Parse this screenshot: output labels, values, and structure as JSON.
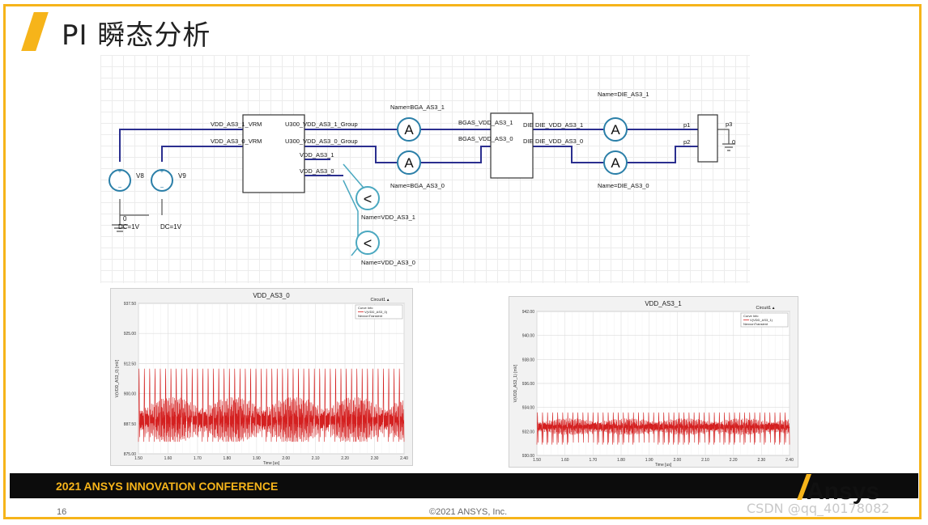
{
  "slide": {
    "title": "PI 瞬态分析",
    "footer_text": "2021 ANSYS INNOVATION CONFERENCE",
    "page_number": "16",
    "copyright": "©2021 ANSYS, Inc.",
    "logo_text": "Ansys",
    "watermark": "CSDN @qq_40178082"
  },
  "colors": {
    "accent": "#f6b41a",
    "footer_bg": "#0c0c0c",
    "wire": "#2b2f8f",
    "probe": "#4ba8c0",
    "signal": "#d42020"
  },
  "schematic": {
    "sources": [
      {
        "name": "V8",
        "param": "DC=1V"
      },
      {
        "name": "V9",
        "param": "DC=1V"
      }
    ],
    "ground_label": "0",
    "vrm_pins": [
      "VDD_AS3_1_VRM",
      "VDD_AS3_0_VRM"
    ],
    "block1_outputs": [
      "U300_VDD_AS3_1_Group",
      "U300_VDD_AS3_0_Group",
      "VDD_AS3_1",
      "VDD_AS3_0"
    ],
    "ammeters": [
      {
        "glyph": "A",
        "label": "Name=BGA_AS3_1"
      },
      {
        "glyph": "A",
        "label": "Name=BGA_AS3_0"
      },
      {
        "glyph": "A",
        "label": "Name=DIE_AS3_1"
      },
      {
        "glyph": "A",
        "label": "Name=DIE_AS3_0"
      }
    ],
    "voltmeters": [
      {
        "glyph": "<",
        "label": "Name=VDD_AS3_1"
      },
      {
        "glyph": "<",
        "label": "Name=VDD_AS3_0"
      }
    ],
    "block2_inputs": [
      "BGAS_VDD_AS3_1",
      "BGAS_VDD_AS3_0"
    ],
    "block2_outputs": [
      "DIE_VDD_AS3_1",
      "DIE_VDD_AS3_0"
    ],
    "die_pins": [
      "DIE",
      "DIE"
    ],
    "port_pins": [
      "p1",
      "p2",
      "p3"
    ],
    "port_ground": "0"
  },
  "chart_data": [
    {
      "type": "line",
      "title": "VDD_AS3_0",
      "legend_title": "Circuit1",
      "legend_entries": [
        "Curve Info",
        "V(VDD_AS3_0)",
        "NexxonTransient"
      ],
      "xlabel": "Time [us]",
      "ylabel": "V(VDD_AS3_0) [mV]",
      "x_ticks": [
        "1.50",
        "1.60",
        "1.70",
        "1.80",
        "1.90",
        "2.00",
        "2.10",
        "2.20",
        "2.30",
        "2.40"
      ],
      "y_ticks": [
        "875.00",
        "887.50",
        "900.00",
        "912.50",
        "925.00",
        "937.50"
      ],
      "xlim": [
        1.5,
        2.4
      ],
      "ylim": [
        875,
        937.5
      ],
      "grid": true,
      "series": [
        {
          "name": "V(VDD_AS3_0)",
          "period": 0.018,
          "high": 914,
          "low": 880,
          "mid": 889
        }
      ]
    },
    {
      "type": "line",
      "title": "VDD_AS3_1",
      "legend_title": "Circuit1",
      "legend_entries": [
        "Curve Info",
        "V(VDD_AS3_1)",
        "NexxonTransient"
      ],
      "xlabel": "Time [us]",
      "ylabel": "V(VDD_AS3_1) [mV]",
      "x_ticks": [
        "1.50",
        "1.60",
        "1.70",
        "1.80",
        "1.90",
        "2.00",
        "2.10",
        "2.20",
        "2.30",
        "2.40"
      ],
      "y_ticks": [
        "930.00",
        "932.00",
        "934.00",
        "936.00",
        "938.00",
        "940.00",
        "942.00"
      ],
      "xlim": [
        1.5,
        2.4
      ],
      "ylim": [
        930,
        942
      ],
      "grid": true,
      "series": [
        {
          "name": "V(VDD_AS3_1)",
          "period": 0.018,
          "high": 933.9,
          "low": 930.9,
          "mid": 932.4
        }
      ]
    }
  ]
}
